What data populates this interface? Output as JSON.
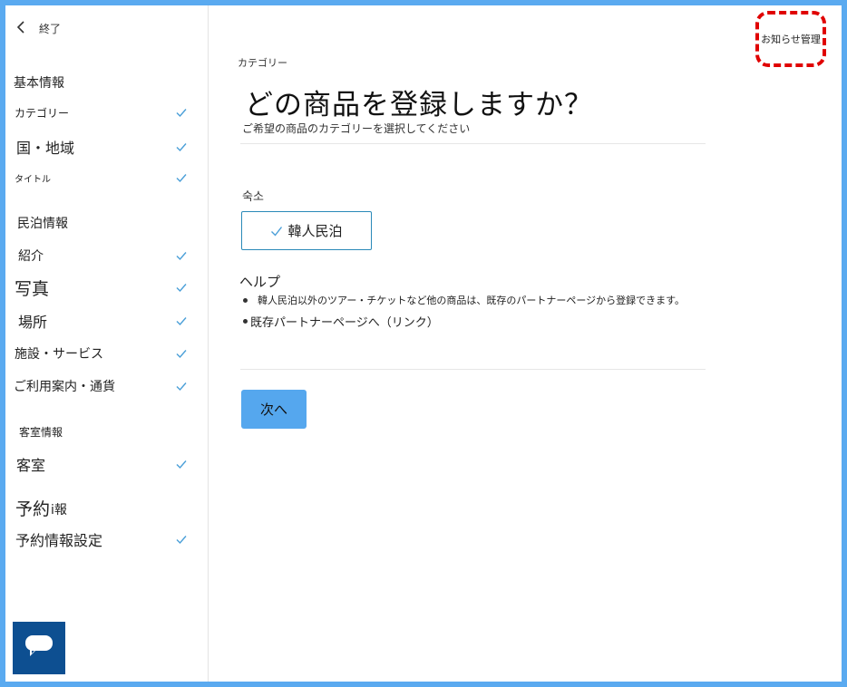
{
  "sidebar": {
    "back_label": "終了",
    "items": [
      {
        "label": "基本情報",
        "checked": false
      },
      {
        "label": "カテゴリー",
        "checked": true
      },
      {
        "label": "国・地域",
        "checked": true
      },
      {
        "label": "タイトル",
        "checked": true
      },
      {
        "label": "民泊情報",
        "checked": false
      },
      {
        "label": "紹介",
        "checked": true
      },
      {
        "label": "写真",
        "checked": true
      },
      {
        "label": "場所",
        "checked": true
      },
      {
        "label": "施設・サービス",
        "checked": true
      },
      {
        "label": "ご利用案内・通貨",
        "checked": true
      },
      {
        "label": "客室情報",
        "checked": false
      },
      {
        "label": "客室",
        "checked": true
      },
      {
        "label": "予約",
        "checked": false
      },
      {
        "label": "i報",
        "checked": false
      },
      {
        "label": "予約情報設定",
        "checked": true
      }
    ]
  },
  "header": {
    "notice_label": "お知らせ管理"
  },
  "main": {
    "eyebrow": "カテゴリー",
    "title": "どの商品を登録しますか？",
    "subtitle": "ご希望の商品のカテゴリーを選択してください",
    "section_label": "숙소",
    "option_label": "韓人民泊",
    "help_title": "ヘルプ",
    "help_items": [
      "韓人民泊以外のツアー・チケットなど他の商品は、既存のパートナーページから登録できます。",
      "既存パートナーページへ（リンク）"
    ],
    "next_label": "次へ"
  },
  "colors": {
    "frame_border": "#5aaaf0",
    "check": "#4a9fd8",
    "option_border": "#2a89b8",
    "next_button": "#55a7ee",
    "chat_button": "#0d4f91",
    "notice_border": "#e00000"
  },
  "icons": {
    "back": "chevron-left-icon",
    "check": "check-icon",
    "chat": "chat-bubble-icon"
  }
}
